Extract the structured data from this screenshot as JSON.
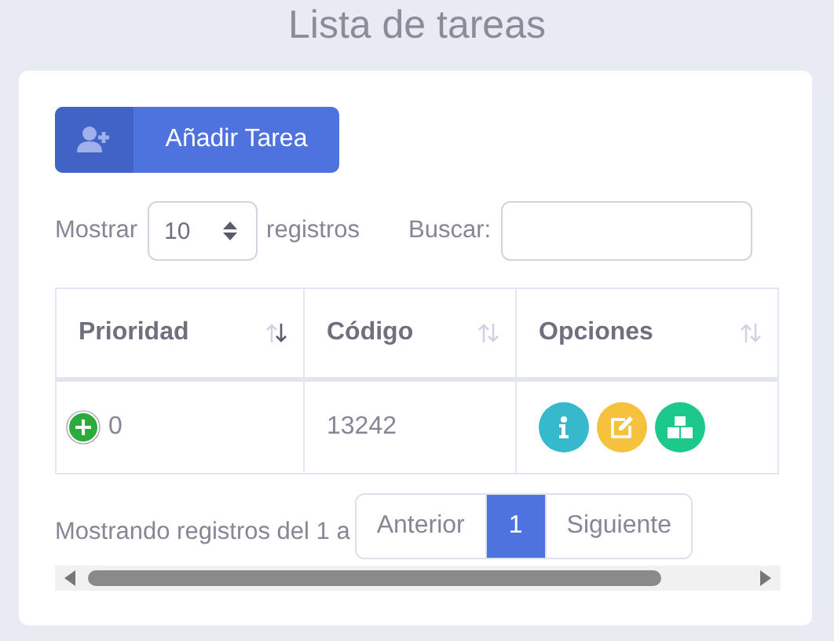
{
  "page_title": "Lista de tareas",
  "add_button": {
    "label": "Añadir Tarea"
  },
  "length": {
    "before": "Mostrar",
    "value": "10",
    "after": "registros"
  },
  "search": {
    "label": "Buscar:"
  },
  "table": {
    "columns": [
      {
        "label": "Prioridad",
        "sorted": true
      },
      {
        "label": "Código",
        "sorted": false
      },
      {
        "label": "Opciones",
        "sorted": false
      }
    ],
    "rows": [
      {
        "priority": "0",
        "code": "13242",
        "actions": [
          {
            "kind": "info"
          },
          {
            "kind": "edit"
          },
          {
            "kind": "boxes"
          }
        ]
      }
    ]
  },
  "info": "Mostrando registros del 1 a",
  "pagination": [
    {
      "label": "Anterior",
      "selected": false
    },
    {
      "label": "1",
      "selected": true
    },
    {
      "label": "Siguiente",
      "selected": false
    }
  ]
}
